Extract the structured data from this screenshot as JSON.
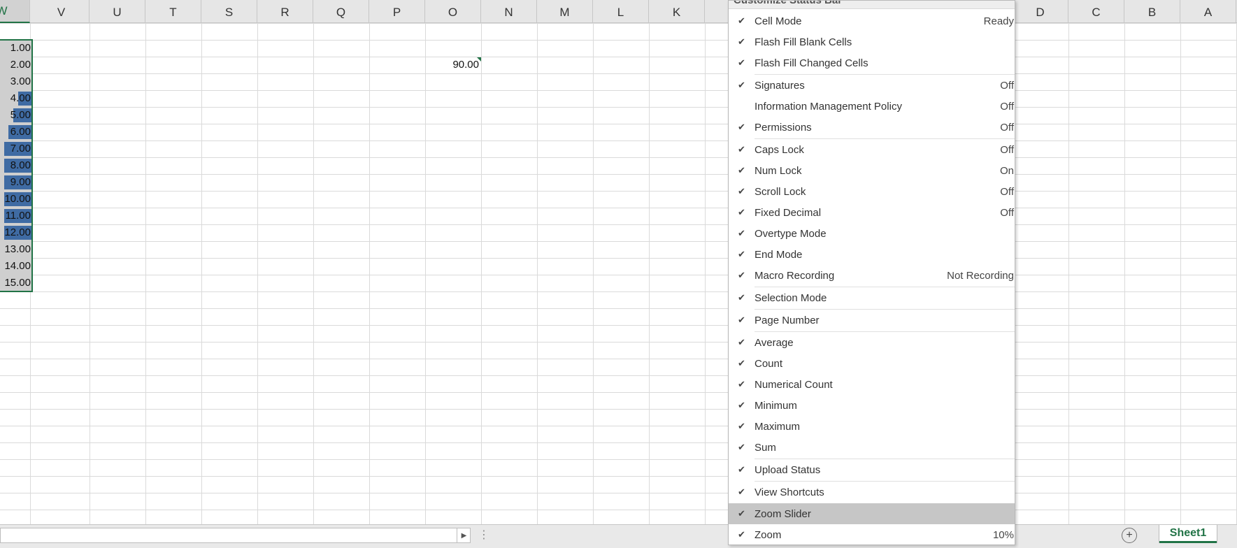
{
  "columns": [
    "W",
    "V",
    "U",
    "T",
    "S",
    "R",
    "Q",
    "P",
    "O",
    "N",
    "M",
    "L",
    "K",
    "D",
    "C",
    "B",
    "A"
  ],
  "selected_column": "W",
  "column_w_values": [
    "1.00",
    "2.00",
    "3.00",
    "4.00",
    "5.00",
    "6.00",
    "7.00",
    "8.00",
    "9.00",
    "10.00",
    "11.00",
    "12.00",
    "13.00",
    "14.00",
    "15.00"
  ],
  "column_w_bar_fill_pct": [
    0,
    0,
    0,
    45,
    60,
    75,
    88,
    88,
    88,
    88,
    88,
    88,
    0,
    0,
    0
  ],
  "cell_o2_value": "90.00",
  "colors": {
    "accent": "#217346",
    "data_bar": "#3f6ba3",
    "selected_gray": "#c6c6c6"
  },
  "menu": {
    "title": "Customize Status Bar",
    "items": [
      {
        "label": "Cell Mode",
        "value": "Ready",
        "checked": true
      },
      {
        "label": "Flash Fill Blank Cells",
        "value": "",
        "checked": true
      },
      {
        "label": "Flash Fill Changed Cells",
        "value": "",
        "checked": true
      },
      {
        "label": "Signatures",
        "value": "Off",
        "checked": true
      },
      {
        "label": "Information Management Policy",
        "value": "Off",
        "checked": false
      },
      {
        "label": "Permissions",
        "value": "Off",
        "checked": true
      },
      {
        "label": "Caps Lock",
        "value": "Off",
        "checked": true
      },
      {
        "label": "Num Lock",
        "value": "On",
        "checked": true
      },
      {
        "label": "Scroll Lock",
        "value": "Off",
        "checked": true
      },
      {
        "label": "Fixed Decimal",
        "value": "Off",
        "checked": true
      },
      {
        "label": "Overtype Mode",
        "value": "",
        "checked": true
      },
      {
        "label": "End Mode",
        "value": "",
        "checked": true
      },
      {
        "label": "Macro Recording",
        "value": "Not Recording",
        "checked": true
      },
      {
        "label": "Selection Mode",
        "value": "",
        "checked": true
      },
      {
        "label": "Page Number",
        "value": "",
        "checked": true
      },
      {
        "label": "Average",
        "value": "",
        "checked": true
      },
      {
        "label": "Count",
        "value": "",
        "checked": true
      },
      {
        "label": "Numerical Count",
        "value": "",
        "checked": true
      },
      {
        "label": "Minimum",
        "value": "",
        "checked": true
      },
      {
        "label": "Maximum",
        "value": "",
        "checked": true
      },
      {
        "label": "Sum",
        "value": "",
        "checked": true
      },
      {
        "label": "Upload Status",
        "value": "",
        "checked": true
      },
      {
        "label": "View Shortcuts",
        "value": "",
        "checked": true
      },
      {
        "label": "Zoom Slider",
        "value": "",
        "checked": true,
        "highlighted": true
      },
      {
        "label": "Zoom",
        "value": "10%",
        "checked": true
      }
    ]
  },
  "sheet_tab": "Sheet1",
  "icons": {
    "check": "check-icon",
    "add_sheet": "plus-circle-icon",
    "scroll_right": "triangle-right-icon"
  }
}
